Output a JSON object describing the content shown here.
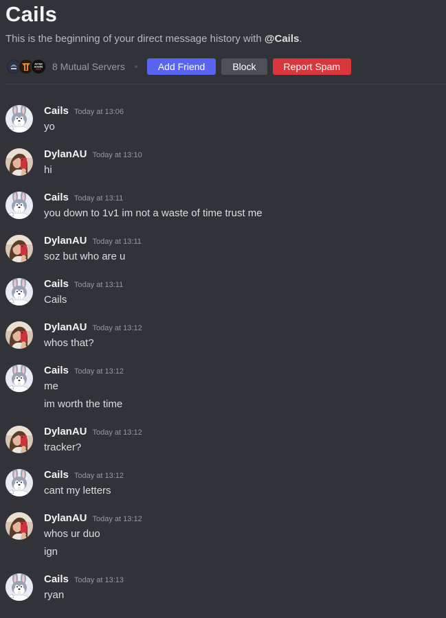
{
  "header": {
    "title": "Cails",
    "intro_prefix": "This is the beginning of your direct message history with ",
    "intro_handle": "@Cails",
    "intro_suffix": "."
  },
  "actions": {
    "mutual_servers": "8 Mutual Servers",
    "add_friend": "Add Friend",
    "block": "Block",
    "report_spam": "Report Spam",
    "server_icons": [
      "server-icon-1",
      "server-icon-2",
      "server-icon-after-hours"
    ],
    "server_icon_text": "AFTER HOURS OCE"
  },
  "colors": {
    "background": "#313338",
    "blurple": "#5865f2",
    "danger": "#da373c",
    "secondary": "#4e5058"
  },
  "messages": [
    {
      "author": "Cails",
      "time": "Today at 13:06",
      "avatar": "bugs-bunny-avatar",
      "lines": [
        "yo"
      ]
    },
    {
      "author": "DylanAU",
      "time": "Today at 13:10",
      "avatar": "selfie-avatar",
      "lines": [
        "hi"
      ]
    },
    {
      "author": "Cails",
      "time": "Today at 13:11",
      "avatar": "bugs-bunny-avatar",
      "lines": [
        "you down to 1v1 im not a waste of time trust me"
      ]
    },
    {
      "author": "DylanAU",
      "time": "Today at 13:11",
      "avatar": "selfie-avatar",
      "lines": [
        "soz but who are u"
      ]
    },
    {
      "author": "Cails",
      "time": "Today at 13:11",
      "avatar": "bugs-bunny-avatar",
      "lines": [
        "Cails"
      ]
    },
    {
      "author": "DylanAU",
      "time": "Today at 13:12",
      "avatar": "selfie-avatar",
      "lines": [
        "whos that?"
      ]
    },
    {
      "author": "Cails",
      "time": "Today at 13:12",
      "avatar": "bugs-bunny-avatar",
      "lines": [
        "me",
        "im worth the time"
      ]
    },
    {
      "author": "DylanAU",
      "time": "Today at 13:12",
      "avatar": "selfie-avatar",
      "lines": [
        "tracker?"
      ]
    },
    {
      "author": "Cails",
      "time": "Today at 13:12",
      "avatar": "bugs-bunny-avatar",
      "lines": [
        "cant my letters"
      ]
    },
    {
      "author": "DylanAU",
      "time": "Today at 13:12",
      "avatar": "selfie-avatar",
      "lines": [
        "whos ur duo",
        "ign"
      ]
    },
    {
      "author": "Cails",
      "time": "Today at 13:13",
      "avatar": "bugs-bunny-avatar",
      "lines": [
        "ryan"
      ]
    }
  ]
}
